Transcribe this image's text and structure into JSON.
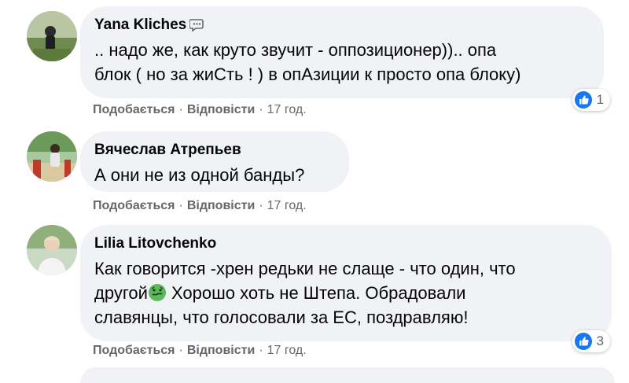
{
  "comments": [
    {
      "author": "Yana Kliches",
      "lines": [
        ".. надо же, как круто звучит - оппозиционер)).. опа",
        "блок ( но за жиСть ! ) в опАзиции к просто опа блоку)"
      ],
      "like_label": "Подобається",
      "reply_label": "Відповісти",
      "time": "17 год.",
      "reactions": "1"
    },
    {
      "author": "Вячеслав Атрепьев",
      "lines": [
        "А они не из одной банды?"
      ],
      "like_label": "Подобається",
      "reply_label": "Відповісти",
      "time": "17 год."
    },
    {
      "author": "Lilia Litovchenko",
      "line1": "Как говорится -хрен редьки не слаще - что один, что",
      "line2_before": "другой",
      "line2_after": " Хорошо хоть не Штепа. Обрадовали",
      "line3": "славянцы, что голосовали за ЕС, поздравляю!",
      "like_label": "Подобається",
      "reply_label": "Відповісти",
      "time": "17 год.",
      "reactions": "3"
    }
  ],
  "separator": "·",
  "colors": {
    "bubble": "#f0f2f5",
    "meta": "#65676b",
    "like_blue": "#1877f2"
  },
  "icons": {
    "author_badge": "message-badge-icon",
    "reaction": "like-icon",
    "emoji": "nauseated-face-emoji"
  }
}
